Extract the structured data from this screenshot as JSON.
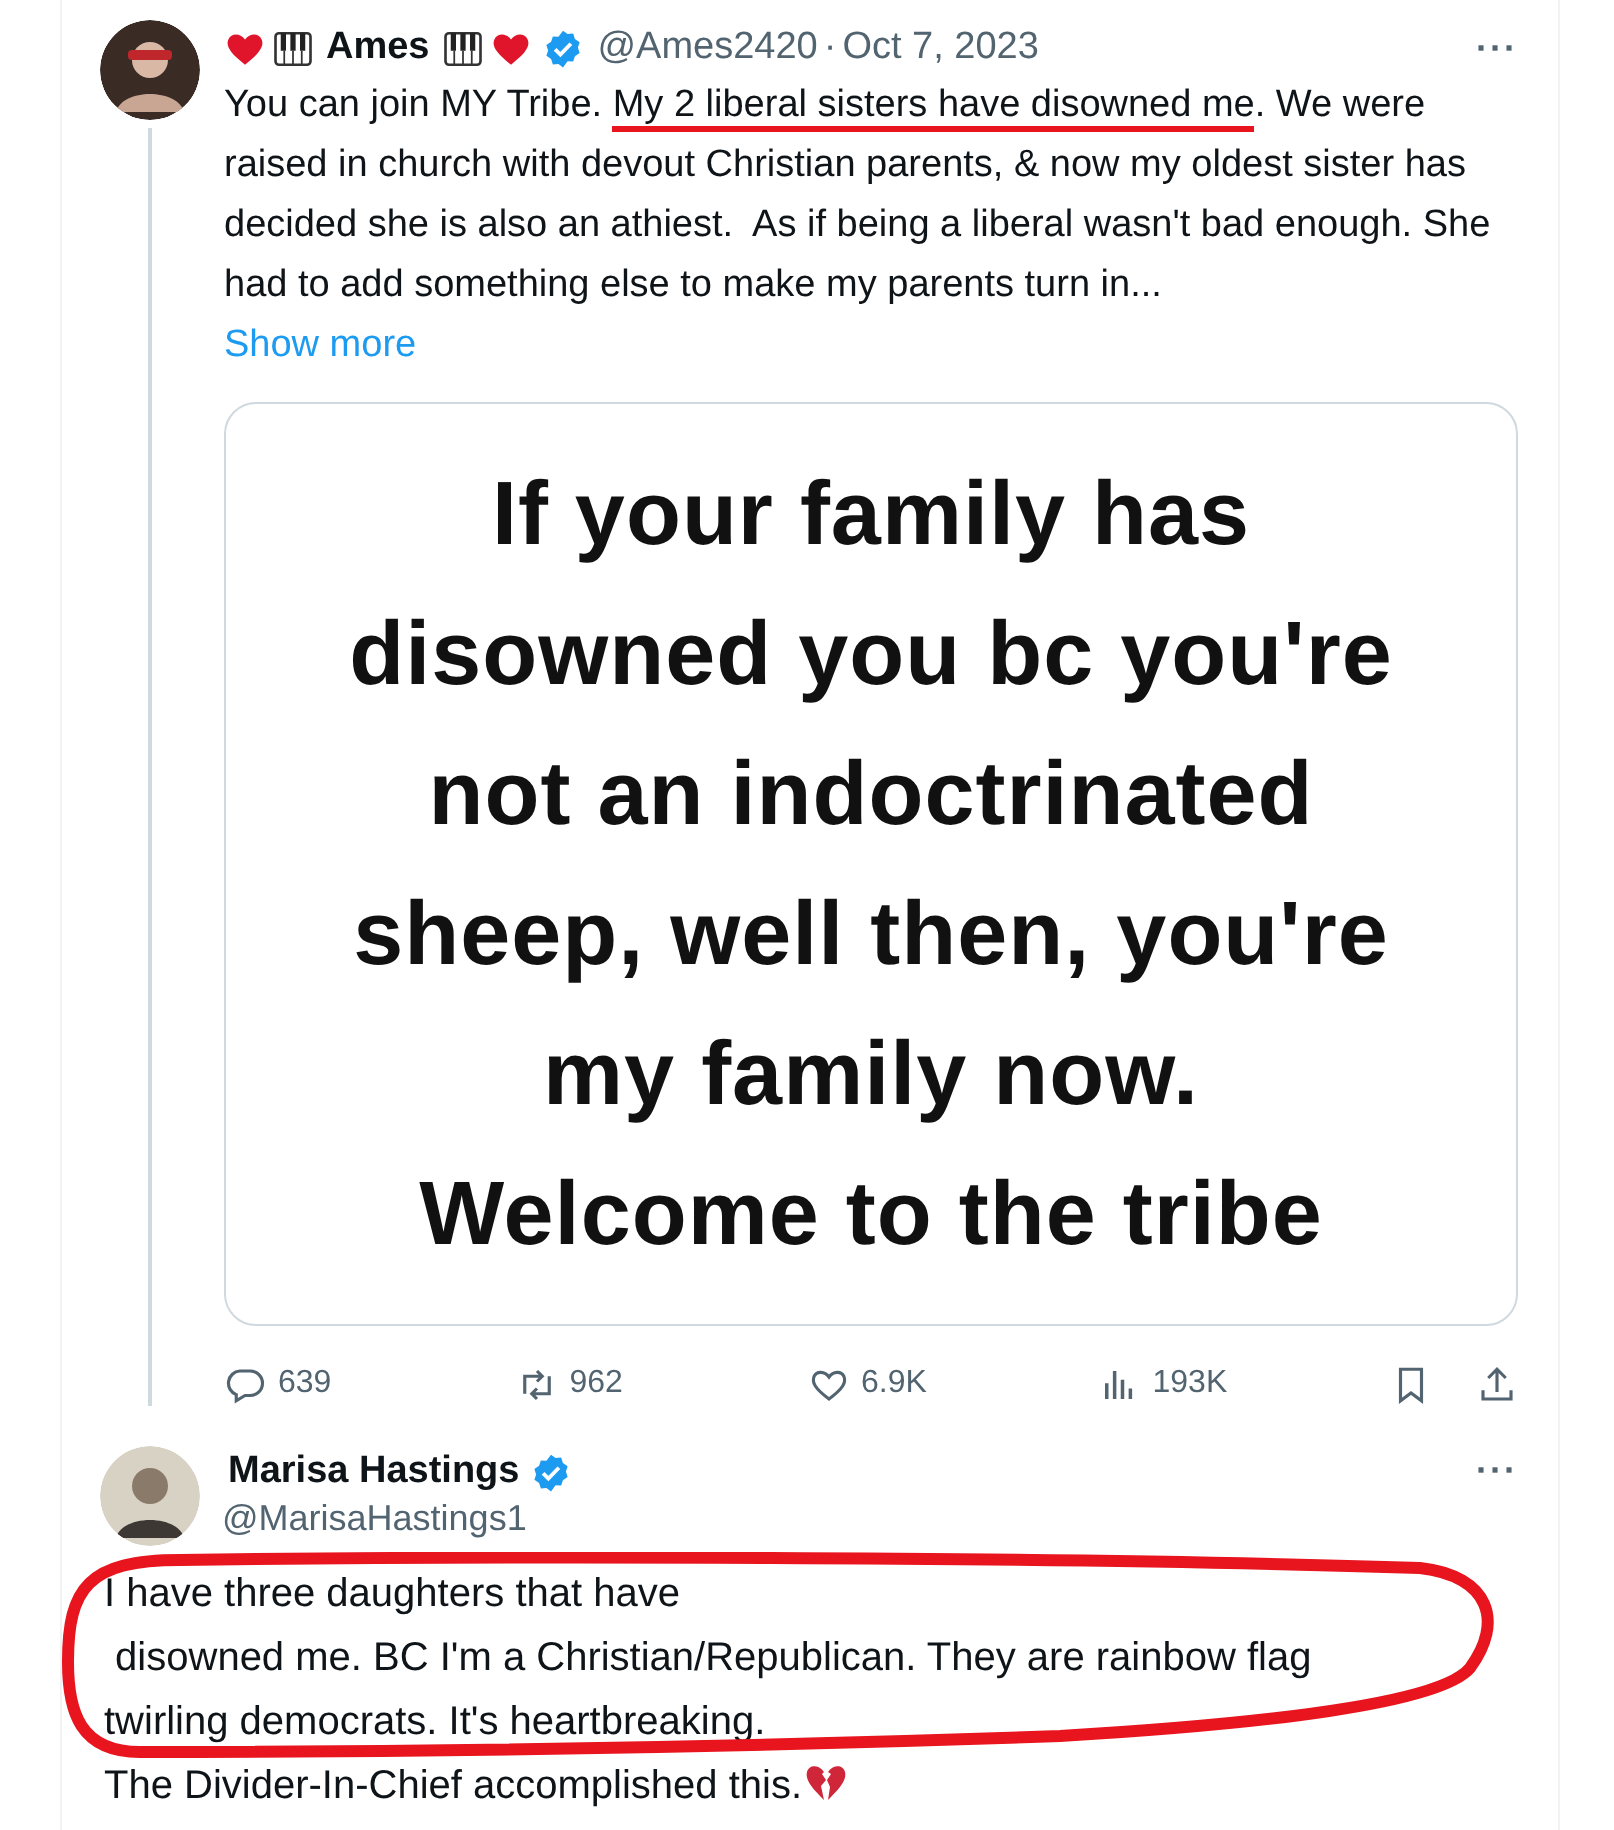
{
  "tweet": {
    "name_prefix_icons": [
      {
        "kind": "heart"
      },
      {
        "kind": "piano"
      }
    ],
    "name": "Ames",
    "name_suffix_icons": [
      {
        "kind": "piano"
      },
      {
        "kind": "heart"
      }
    ],
    "verified": true,
    "handle": "@Ames2420",
    "separator": "·",
    "date": "Oct 7, 2023",
    "more": "···",
    "body": [
      {
        "text": "You can join MY Tribe. ",
        "underlined": false
      },
      {
        "text": "My 2 liberal sisters have disowned me",
        "underlined": true
      },
      {
        "text": ". We were\nraised in church with devout Christian parents, & now my oldest sister has\ndecided she is also an athiest.  As if being a liberal wasn't bad enough. She\nhad to add something else to make my parents turn in...",
        "underlined": false
      }
    ],
    "show_more": "Show more",
    "image_text": "If your family has\ndisowned you bc you're\nnot an indoctrinated\nsheep, well then, you're\nmy family now.\nWelcome to the tribe",
    "stats": [
      {
        "kind": "reply",
        "count": "639"
      },
      {
        "kind": "repost",
        "count": "962"
      },
      {
        "kind": "like",
        "count": "6.9K"
      },
      {
        "kind": "views",
        "count": "193K"
      }
    ],
    "actions": [
      {
        "kind": "bookmark"
      },
      {
        "kind": "share"
      }
    ]
  },
  "reply": {
    "name": "Marisa Hastings",
    "verified": true,
    "handle": "@MarisaHastings1",
    "more": "···",
    "circled": true,
    "body": "I have three daughters that have\n disowned me. BC I'm a Christian/Republican. They are rainbow flag\ntwirling democrats. It's heartbreaking.\nThe Divider-In-Chief accomplished this.",
    "trailing_icon": {
      "kind": "broken-heart"
    }
  }
}
